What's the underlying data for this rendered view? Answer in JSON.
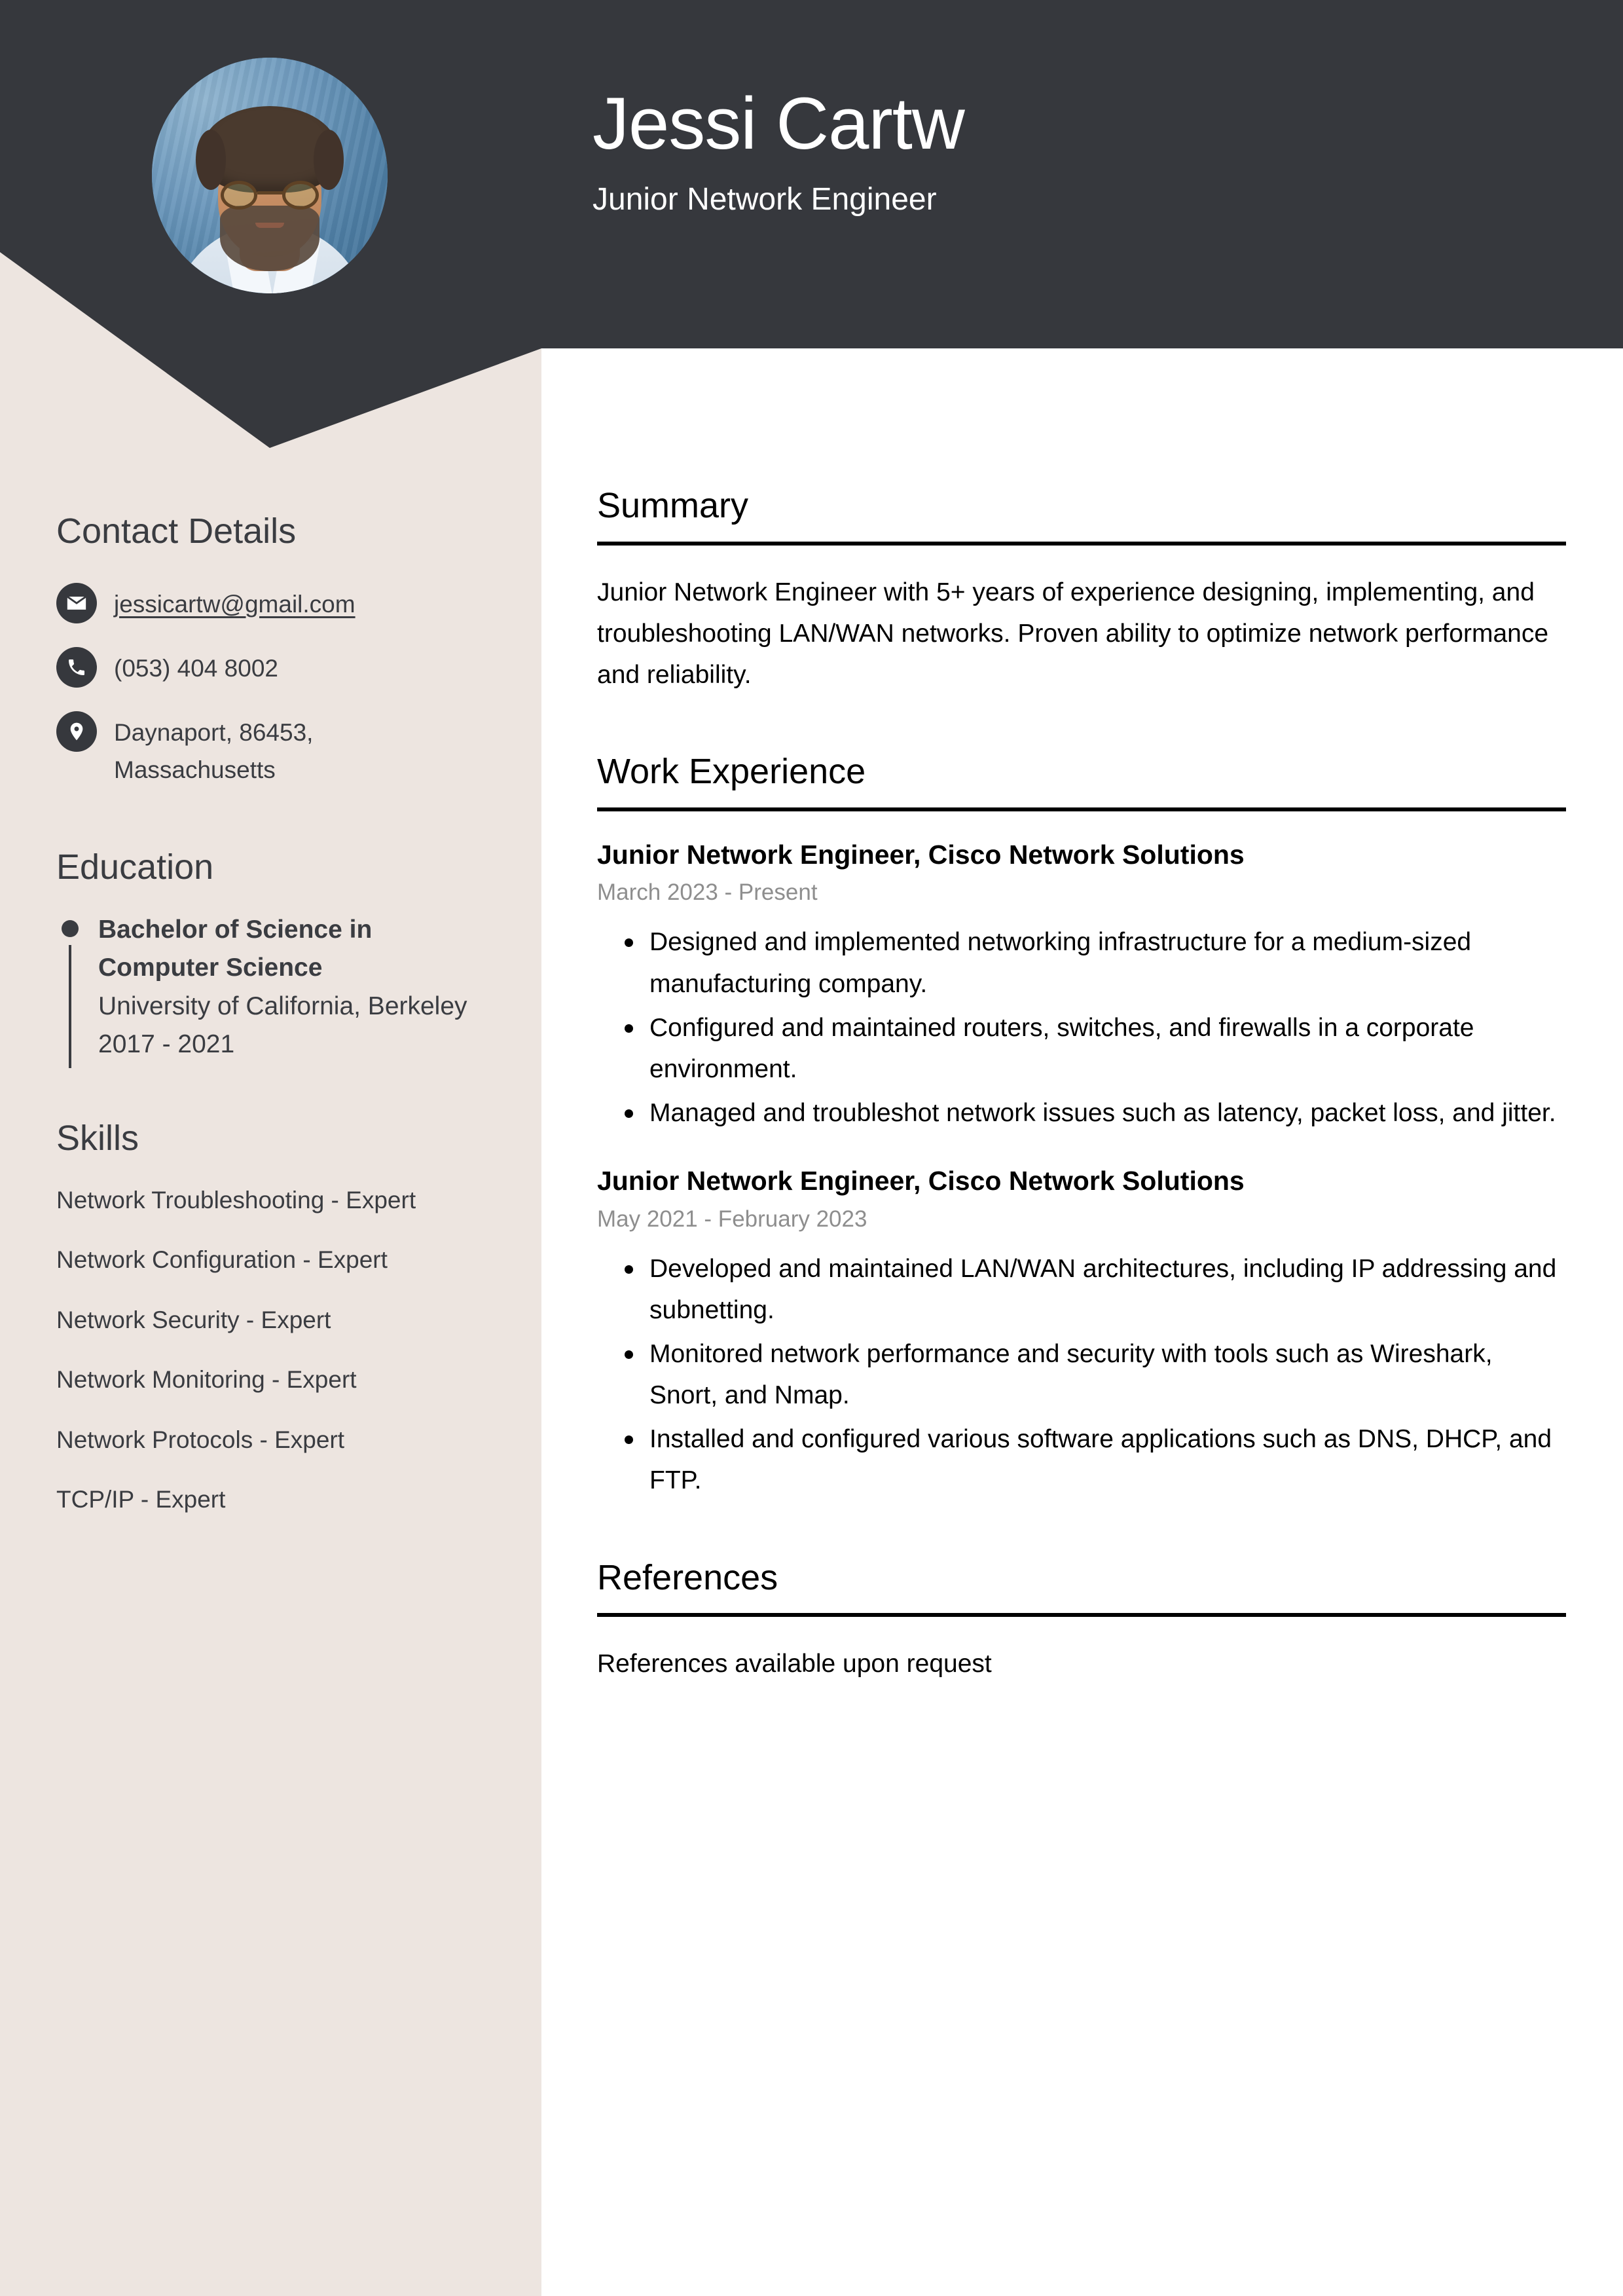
{
  "colors": {
    "header_bg": "#36383D",
    "sidebar_bg": "#EDE5E0",
    "main_bg": "#FFFFFF",
    "text_dark": "#3A3C41",
    "text_black": "#000000",
    "date_gray": "#8E8E8E"
  },
  "header": {
    "name": "Jessi Cartw",
    "title": "Junior Network Engineer",
    "avatar_alt": "profile-photo"
  },
  "sidebar": {
    "contact": {
      "heading": "Contact Details",
      "items": [
        {
          "icon": "envelope-icon",
          "value": "jessicartw@gmail.com",
          "type": "email"
        },
        {
          "icon": "phone-icon",
          "value": "(053) 404 8002",
          "type": "phone"
        },
        {
          "icon": "location-pin-icon",
          "value": "Daynaport, 86453, Massachusetts",
          "type": "address"
        }
      ]
    },
    "education": {
      "heading": "Education",
      "items": [
        {
          "degree": "Bachelor of Science in Computer Science",
          "institution": "University of California, Berkeley",
          "dates": "2017 - 2021"
        }
      ]
    },
    "skills": {
      "heading": "Skills",
      "items": [
        "Network Troubleshooting - Expert",
        "Network Configuration - Expert",
        "Network Security - Expert",
        "Network Monitoring - Expert",
        "Network Protocols - Expert",
        "TCP/IP - Expert"
      ]
    }
  },
  "main": {
    "summary": {
      "heading": "Summary",
      "text": "Junior Network Engineer with 5+ years of experience designing, implementing, and troubleshooting LAN/WAN networks. Proven ability to optimize network performance and reliability."
    },
    "work_experience": {
      "heading": "Work Experience",
      "jobs": [
        {
          "title": "Junior Network Engineer, Cisco Network Solutions",
          "dates": "March 2023 - Present",
          "bullets": [
            "Designed and implemented networking infrastructure for a medium-sized manufacturing company.",
            "Configured and maintained routers, switches, and firewalls in a corporate environment.",
            "Managed and troubleshot network issues such as latency, packet loss, and jitter."
          ]
        },
        {
          "title": "Junior Network Engineer, Cisco Network Solutions",
          "dates": "May 2021 - February 2023",
          "bullets": [
            "Developed and maintained LAN/WAN architectures, including IP addressing and subnetting.",
            "Monitored network performance and security with tools such as Wireshark, Snort, and Nmap.",
            "Installed and configured various software applications such as DNS, DHCP, and FTP."
          ]
        }
      ]
    },
    "references": {
      "heading": "References",
      "text": "References available upon request"
    }
  }
}
